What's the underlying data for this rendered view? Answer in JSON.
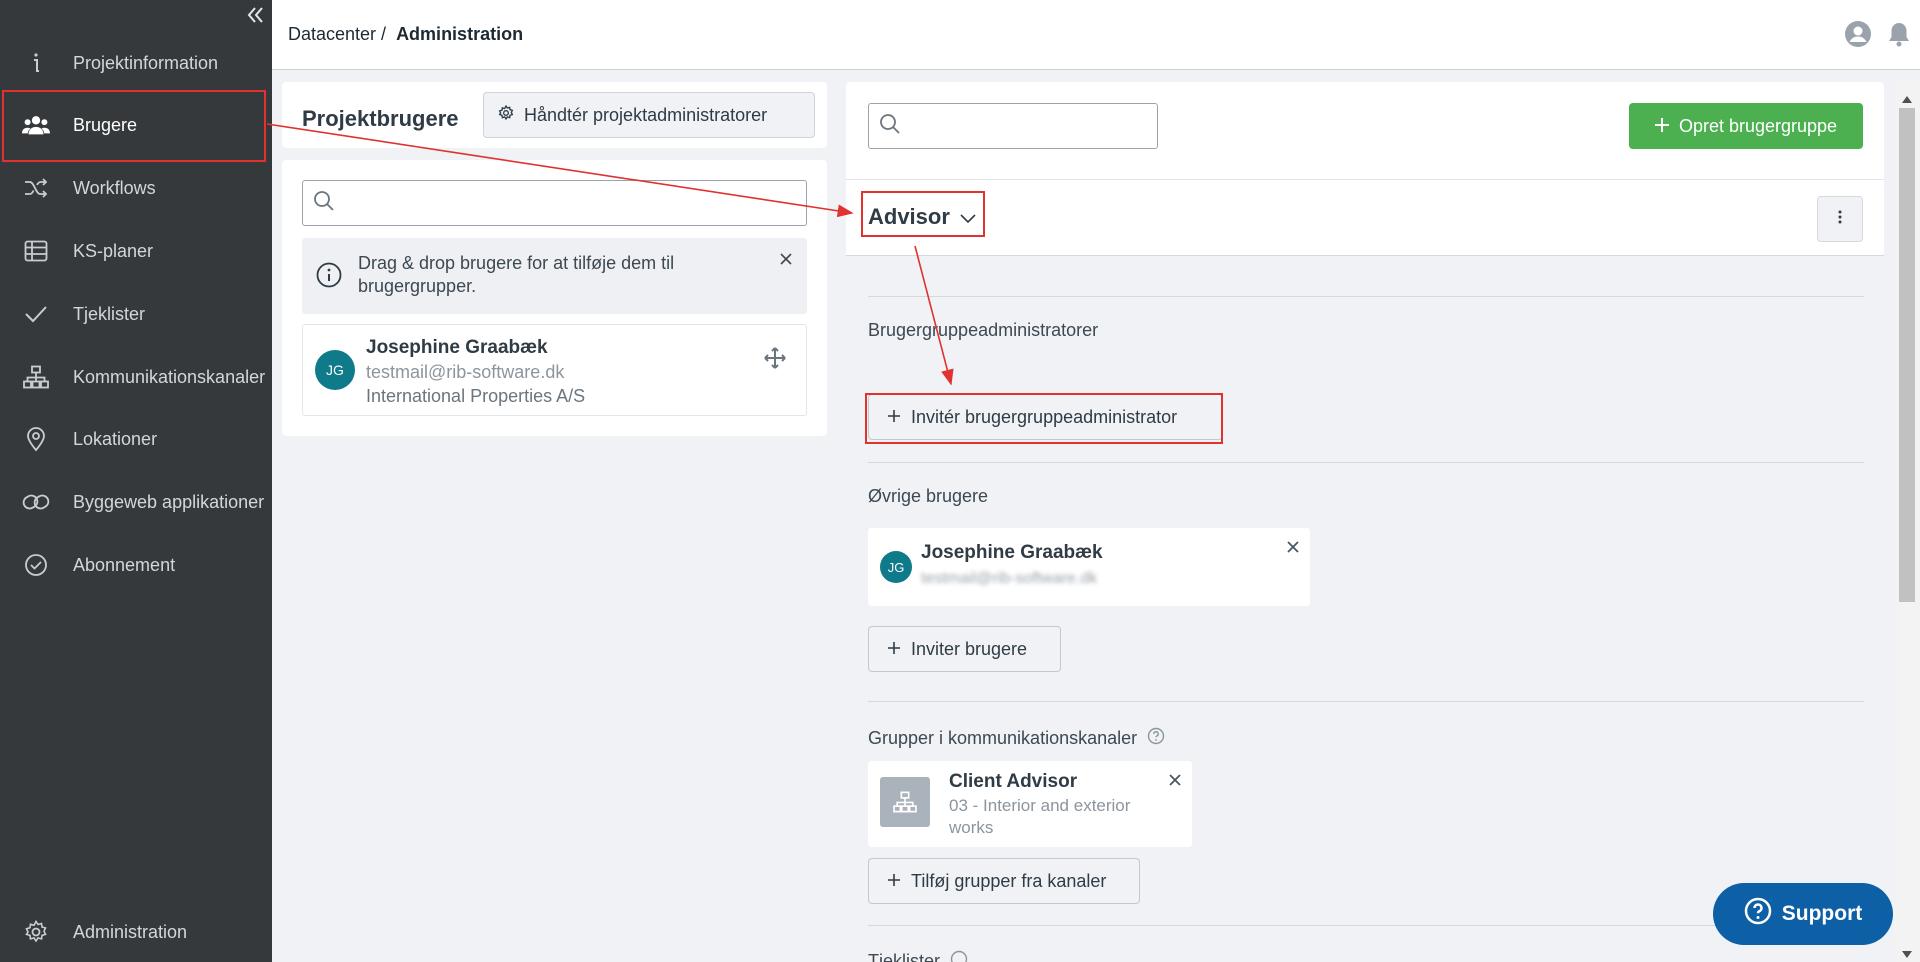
{
  "sidebar": {
    "items": [
      {
        "label": "Projektinformation",
        "icon": "info-icon"
      },
      {
        "label": "Brugere",
        "icon": "users-icon",
        "active": true
      },
      {
        "label": "Workflows",
        "icon": "shuffle-icon"
      },
      {
        "label": "KS-planer",
        "icon": "table-icon"
      },
      {
        "label": "Tjeklister",
        "icon": "checkmark-icon"
      },
      {
        "label": "Kommunikationskanaler",
        "icon": "hierarchy-icon"
      },
      {
        "label": "Lokationer",
        "icon": "map-pin-icon"
      },
      {
        "label": "Byggeweb applikationer",
        "icon": "link-icon"
      },
      {
        "label": "Abonnement",
        "icon": "check-circle-icon"
      }
    ],
    "footer": {
      "label": "Administration",
      "icon": "gear-icon"
    }
  },
  "header": {
    "breadcrumb_root": "Datacenter /",
    "breadcrumb_current": "Administration"
  },
  "project_users": {
    "title": "Projektbrugere",
    "manage_admins_label": "Håndtér projektadministratorer",
    "search_placeholder": "",
    "info_text": "Drag & drop brugere for at tilføje dem til brugergrupper.",
    "users": [
      {
        "initials": "JG",
        "name": "Josephine Graabæk",
        "email": "testmail@rib-software.dk",
        "company": "International Properties A/S"
      }
    ]
  },
  "group_panel": {
    "search_placeholder": "",
    "create_group_label": "Opret brugergruppe",
    "group_name": "Advisor",
    "admins_label": "Brugergruppeadministratorer",
    "invite_admin_label": "Invitér brugergruppeadministrator",
    "other_users_label": "Øvrige brugere",
    "other_users": [
      {
        "initials": "JG",
        "name": "Josephine Graabæk",
        "email_hidden": "testmail@rib-software.dk"
      }
    ],
    "invite_users_label": "Inviter brugere",
    "channels_label": "Grupper i kommunikationskanaler",
    "channel_groups": [
      {
        "name": "Client Advisor",
        "channel_line1": "03 - Interior and exterior",
        "channel_line2": "works"
      }
    ],
    "add_channel_groups_label": "Tilføj grupper fra kanaler",
    "checklists_label": "Tjeklister"
  },
  "support": {
    "label": "Support"
  },
  "colors": {
    "sidebar_bg": "#35393c",
    "accent_green": "#4caf50",
    "avatar_teal": "#0f7a89",
    "support_blue": "#0d5fa6",
    "annotation_red": "#e0322f"
  }
}
